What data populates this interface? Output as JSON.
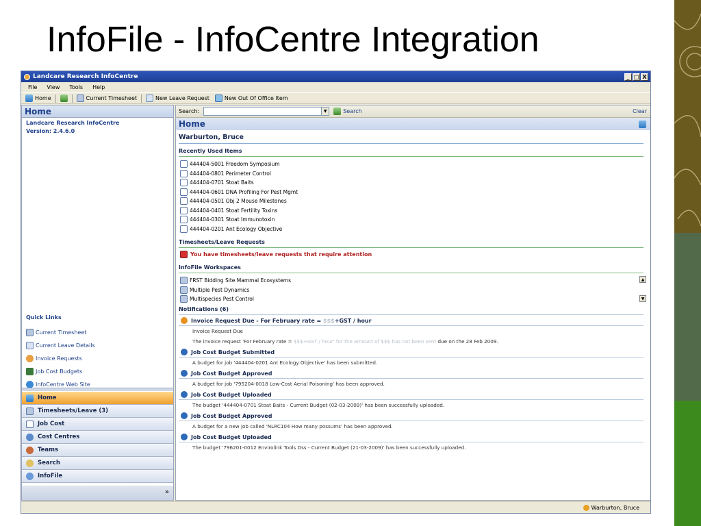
{
  "slide": {
    "title": "InfoFile - InfoCentre Integration"
  },
  "window": {
    "title": "Landcare Research InfoCentre",
    "buttons": [
      "_",
      "□",
      "X"
    ]
  },
  "menu": [
    "File",
    "View",
    "Tools",
    "Help"
  ],
  "toolbar": {
    "home": "Home",
    "current_timesheet": "Current Timesheet",
    "new_leave": "New Leave Request",
    "new_ooo": "New Out Of Office Item"
  },
  "left": {
    "header": "Home",
    "app_name": "Landcare Research InfoCentre",
    "version": "Version: 2.4.6.0",
    "quick_links_title": "Quick Links",
    "quick_links": [
      {
        "label": "Current Timesheet",
        "icon": "timesheet-icon"
      },
      {
        "label": "Current Leave Details",
        "icon": "leave-icon"
      },
      {
        "label": "Invoice Requests",
        "icon": "invoice-icon"
      },
      {
        "label": "Job Cost Budgets",
        "icon": "budget-icon"
      },
      {
        "label": "InfoCentre Web Site",
        "icon": "web-icon"
      }
    ],
    "nav": [
      {
        "label": "Home",
        "active": true
      },
      {
        "label": "Timesheets/Leave (3)",
        "active": false
      },
      {
        "label": "Job Cost",
        "active": false
      },
      {
        "label": "Cost Centres",
        "active": false
      },
      {
        "label": "Teams",
        "active": false
      },
      {
        "label": "Search",
        "active": false
      },
      {
        "label": "InfoFile",
        "active": false
      }
    ],
    "nav_footer": "»"
  },
  "search": {
    "label": "Search:",
    "button": "Search",
    "clear": "Clear",
    "value": ""
  },
  "main": {
    "header": "Home",
    "user": "Warburton, Bruce",
    "recent_title": "Recently Used Items",
    "recent_items": [
      "444404-5001 Freedom Symposium",
      "444404-0801 Perimeter Control",
      "444404-0701 Stoat Baits",
      "444404-0601 DNA Profiling For Pest Mgmt",
      "444404-0501 Obj 2 Mouse Milestones",
      "444404-0401 Stoat Fertility Toxins",
      "444404-0301 Stoat Immunotoxin",
      "444404-0201 Ant Ecology Objective"
    ],
    "timesheets_title": "Timesheets/Leave Requests",
    "attention": "You have timesheets/leave requests that require attention",
    "workspaces_title": "InfoFile Workspaces",
    "workspaces": [
      "FRST Bidding Site Mammal Ecosystems",
      "Multiple Pest Dynamics",
      "Multispecies Pest Control"
    ],
    "notifications_title": "Notifications (6)",
    "notifications": [
      {
        "title": "Invoice Request Due - For February rate = ",
        "title_blur": "$$$",
        "title_tail": "+GST / hour",
        "subtitle": "Invoice Request Due",
        "body": "The invoice request 'For February rate = ",
        "body_blur": "$$$+GST / hour' for the amount of $$$ has not been sent",
        "body_tail": " due on the 28 Feb 2009.",
        "kind": "alert"
      },
      {
        "title": "Job Cost Budget Submitted",
        "body": "A budget for job '444404-0201 Ant Ecology Objective' has been submitted.",
        "kind": "info"
      },
      {
        "title": "Job Cost Budget Approved",
        "body": "A budget for job '795204-0018 Low-Cost Aerial Poisoning' has been approved.",
        "kind": "info"
      },
      {
        "title": "Job Cost Budget Uploaded",
        "body": "The budget '444404-0701 Stoat Baits - Current Budget (02-03-2009)' has been successfully uploaded.",
        "kind": "info"
      },
      {
        "title": "Job Cost Budget Approved",
        "body": "A budget for a new job called 'NLRC104 How many possums' has been approved.",
        "kind": "info"
      },
      {
        "title": "Job Cost Budget Uploaded",
        "body": "The budget '796201-0012 Envirolink Tools Dss - Current Budget (21-03-2009)' has been successfully uploaded.",
        "kind": "info"
      }
    ]
  },
  "status": {
    "user": "Warburton, Bruce"
  },
  "colors": {
    "accent": "#1d3f8a",
    "active_nav": "#f0a030",
    "warning": "#b02020"
  }
}
